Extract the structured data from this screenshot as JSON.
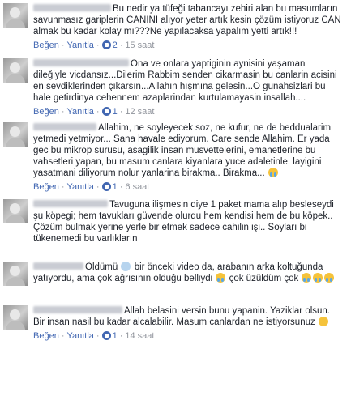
{
  "comments": [
    {
      "text": "Bu nedir ya tüfeği tabancayı zehiri alan bu masumların savunmasız gariplerin CANINI alıyor yeter artık kesin çözüm istiyoruz CAN almak bu kadar kolay mı???Ne yapılacaksa yapalım yetti artık!!!",
      "like_label": "Beğen",
      "reply_label": "Yanıtla",
      "likes": "2",
      "time": "15 saat",
      "reactions": [],
      "show_likes": true
    },
    {
      "text": "Ona ve onlara yaptiginin aynisini yaşaman dileğiyle vicdansız...Dilerim Rabbim senden cikarmasin bu canlarin acisini en sevdiklerinden çıkarsın...Allahın hışmına gelesin...O gunahsizlari bu hale getirdinya cehennem azaplarindan kurtulamayasin insallah....",
      "like_label": "Beğen",
      "reply_label": "Yanıtla",
      "likes": "1",
      "time": "12 saat",
      "reactions": [],
      "show_likes": true
    },
    {
      "text": "Allahim, ne soyleyecek soz, ne kufur, ne de beddualarim yetmedi yetmiyor... Sana havale ediyorum. Care sende Allahim. Er yada gec bu mikrop surusu, asagilik insan musvettelerini, emanetlerine bu vahsetleri yapan, bu masum canlara kiyanlara yuce adaletinle, layigini yasatmani diliyorum nolur yanlarina birakma.. Birakma...",
      "like_label": "Beğen",
      "reply_label": "Yanıtla",
      "likes": "1",
      "time": "6 saat",
      "reactions": [
        "cry"
      ],
      "show_likes": true
    },
    {
      "text": "Tavuguna ilişmesin diye 1 paket mama alıp besleseydi şu köpegi; hem tavukları güvende olurdu hem kendisi hem de bu köpek.. Çözüm bulmak yerine yerle bir etmek sadece cahilin işi.. Soyları bi tükenemedi bu varlıkların",
      "like_label": "Beğen",
      "reply_label": "Yanıtla",
      "likes": "",
      "time": "",
      "reactions": [],
      "show_likes": false
    },
    {
      "text_pre": "Öldümü",
      "text_mid": "bir önceki video da, arabanın arka koltuğunda yatıyordu, ama çok ağrısının olduğu belliydi",
      "text_post": "çok üzüldüm çok",
      "like_label": "Beğen",
      "reply_label": "Yanıtla",
      "likes": "",
      "time": "",
      "show_likes": false
    },
    {
      "text": "Allah belasini versin bunu yapanin. Yaziklar olsun. Bir insan nasil bu kadar alcalabilir. Masum canlardan ne istiyorsunuz",
      "like_label": "Beğen",
      "reply_label": "Yanıtla",
      "likes": "1",
      "time": "14 saat",
      "reactions": [
        "smile"
      ],
      "show_likes": true
    }
  ],
  "colors": {
    "link": "#4267b2",
    "meta": "#90949c",
    "text": "#1d2129"
  }
}
